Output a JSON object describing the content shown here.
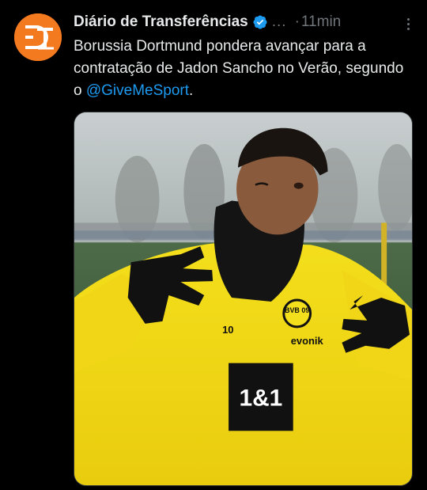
{
  "tweet": {
    "display_name": "Diário de Transferências",
    "handle_ellipsis": "...",
    "separator": "·",
    "time": "11min",
    "text_before_mention": "Borussia Dortmund pondera avançar para a contratação de Jadon Sancho no Verão, segundo o ",
    "mention": "@GiveMeSport",
    "text_after_mention": ".",
    "avatar_initials": "DT",
    "colors": {
      "avatar_bg": "#f47a20",
      "verified_badge": "#1d9bf0",
      "mention": "#1d9bf0",
      "muted": "#71767b"
    },
    "icons": [
      "verified-badge-icon",
      "more-options-icon"
    ]
  },
  "media": {
    "jersey_number": "10",
    "sponsor": "1&1",
    "brand": "evonik",
    "crest": "BVB 09"
  }
}
